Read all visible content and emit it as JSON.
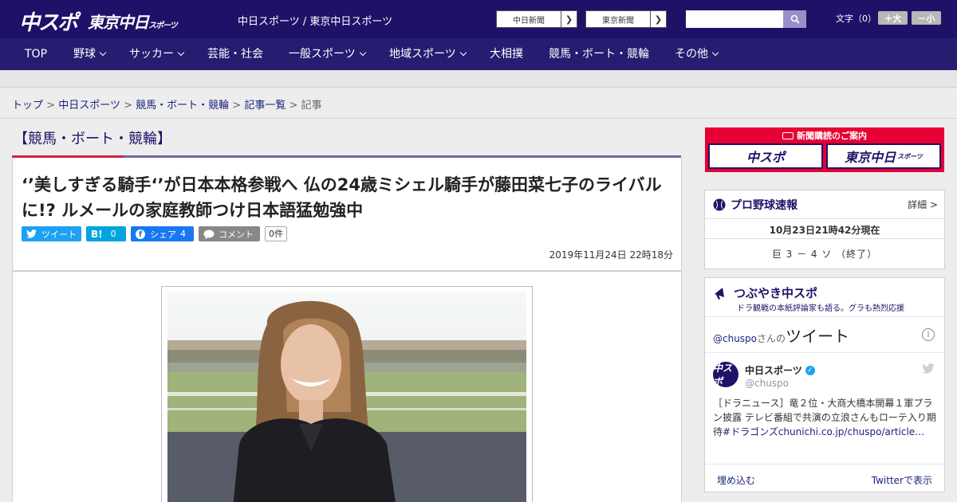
{
  "header": {
    "logo_chuspo": "中スポ",
    "logo_tokyo": "東京中日",
    "logo_tokyo_small": "スポーツ",
    "site_link": "中日スポーツ / 東京中日スポーツ",
    "btn_chunichi": "中日新聞",
    "btn_tokyo": "東京新聞",
    "font_size_label": "文字（0）",
    "font_bigger": "＋大",
    "font_smaller": "－小"
  },
  "nav": {
    "items": [
      {
        "label": "TOP"
      },
      {
        "label": "野球"
      },
      {
        "label": "サッカー"
      },
      {
        "label": "芸能・社会"
      },
      {
        "label": "一般スポーツ"
      },
      {
        "label": "地域スポーツ"
      },
      {
        "label": "大相撲"
      },
      {
        "label": "競馬・ボート・競輪"
      },
      {
        "label": "その他"
      }
    ]
  },
  "breadcrumb": {
    "items": [
      "トップ",
      "中日スポーツ",
      "競馬・ボート・競輪",
      "記事一覧"
    ],
    "current": "記事",
    "separator": ">"
  },
  "section": {
    "title": "【競馬・ボート・競輪】"
  },
  "article": {
    "title": "‘’美しすぎる騎手‘’が日本本格参戦へ 仏の24歳ミシェル騎手が藤田菜七子のライバルに!? ルメールの家庭教師つけ日本語猛勉強中",
    "share_tweet": "ツイート",
    "share_hatena_count": "0",
    "share_fb": "シェア",
    "share_fb_count": "4",
    "share_comment": "コメント",
    "comment_count": "0件",
    "date": "2019年11月24日 22時18分"
  },
  "sidebar": {
    "subscribe_heading": "新聞購読のご案内",
    "subscribe_chuspo": "中スポ",
    "subscribe_tokyo": "東京中日",
    "subscribe_tokyo_small": "スポーツ",
    "baseball_title": "プロ野球速報",
    "baseball_detail": "詳細 >",
    "baseball_time": "10月23日21時42分現在",
    "baseball_score": "巨 3 － 4 ソ （終了）",
    "tsubuyaki_title": "つぶやき中スポ",
    "tsubuyaki_sub": "ドラ観戦の本紙評論家も語る。グラも熱烈応援",
    "tw_handle": "@chuspo",
    "tw_handle_suffix": "さんの",
    "tw_tweet_label": "ツイート",
    "tw_name": "中日スポーツ",
    "tw_user": "@chuspo",
    "tw_avatar_text": "中スポ",
    "tw_text": "［ドラニュース］竜２位・大商大橋本開幕１軍プラン披露 テレビ番組で共演の立浪さんもローテ入り期待",
    "tw_link": "#ドラゴンズchunichi.co.jp/chuspo/article…",
    "tw_embed": "埋め込む",
    "tw_view": "Twitterで表示"
  },
  "colors": {
    "header_bg": "#1e1268",
    "nav_bg": "#261c70",
    "accent_red": "#d0243b",
    "subscribe_red": "#e60033"
  }
}
